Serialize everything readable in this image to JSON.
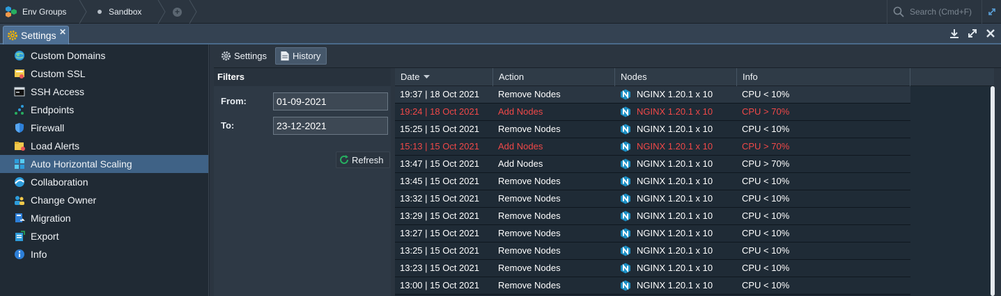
{
  "topbar": {
    "env_groups": "Env Groups",
    "sandbox": "Sandbox",
    "search_placeholder": "Search (Cmd+F)"
  },
  "tab": {
    "label": "Settings",
    "close": "✕"
  },
  "sidebar": {
    "items": [
      {
        "label": "Custom Domains",
        "icon": "globe-icon"
      },
      {
        "label": "Custom SSL",
        "icon": "certificate-icon"
      },
      {
        "label": "SSH Access",
        "icon": "terminal-icon"
      },
      {
        "label": "Endpoints",
        "icon": "endpoints-icon"
      },
      {
        "label": "Firewall",
        "icon": "shield-icon"
      },
      {
        "label": "Load Alerts",
        "icon": "alert-folder-icon"
      },
      {
        "label": "Auto Horizontal Scaling",
        "icon": "scaling-icon",
        "active": true
      },
      {
        "label": "Collaboration",
        "icon": "collaboration-icon"
      },
      {
        "label": "Change Owner",
        "icon": "change-owner-icon"
      },
      {
        "label": "Migration",
        "icon": "migration-icon"
      },
      {
        "label": "Export",
        "icon": "export-icon"
      },
      {
        "label": "Info",
        "icon": "info-icon"
      }
    ]
  },
  "subtabs": {
    "settings": "Settings",
    "history": "History"
  },
  "filters": {
    "title": "Filters",
    "from_label": "From:",
    "from_value": "01-09-2021",
    "to_label": "To:",
    "to_value": "23-12-2021",
    "refresh": "Refresh"
  },
  "grid": {
    "columns": [
      "Date",
      "Action",
      "Nodes",
      "Info"
    ],
    "rows": [
      {
        "date": "19:37 | 18 Oct 2021",
        "action": "Remove Nodes",
        "nodes": "NGINX 1.20.1 x 10",
        "info": "CPU < 10%",
        "alert": false
      },
      {
        "date": "19:24 | 18 Oct 2021",
        "action": "Add Nodes",
        "nodes": "NGINX 1.20.1 x 10",
        "info": "CPU > 70%",
        "alert": true
      },
      {
        "date": "15:25 | 15 Oct 2021",
        "action": "Remove Nodes",
        "nodes": "NGINX 1.20.1 x 10",
        "info": "CPU < 10%",
        "alert": false
      },
      {
        "date": "15:13 | 15 Oct 2021",
        "action": "Add Nodes",
        "nodes": "NGINX 1.20.1 x 10",
        "info": "CPU > 70%",
        "alert": true
      },
      {
        "date": "13:47 | 15 Oct 2021",
        "action": "Add Nodes",
        "nodes": "NGINX 1.20.1 x 10",
        "info": "CPU > 70%",
        "alert": false
      },
      {
        "date": "13:45 | 15 Oct 2021",
        "action": "Remove Nodes",
        "nodes": "NGINX 1.20.1 x 10",
        "info": "CPU < 10%",
        "alert": false
      },
      {
        "date": "13:32 | 15 Oct 2021",
        "action": "Remove Nodes",
        "nodes": "NGINX 1.20.1 x 10",
        "info": "CPU < 10%",
        "alert": false
      },
      {
        "date": "13:29 | 15 Oct 2021",
        "action": "Remove Nodes",
        "nodes": "NGINX 1.20.1 x 10",
        "info": "CPU < 10%",
        "alert": false
      },
      {
        "date": "13:27 | 15 Oct 2021",
        "action": "Remove Nodes",
        "nodes": "NGINX 1.20.1 x 10",
        "info": "CPU < 10%",
        "alert": false
      },
      {
        "date": "13:25 | 15 Oct 2021",
        "action": "Remove Nodes",
        "nodes": "NGINX 1.20.1 x 10",
        "info": "CPU < 10%",
        "alert": false
      },
      {
        "date": "13:23 | 15 Oct 2021",
        "action": "Remove Nodes",
        "nodes": "NGINX 1.20.1 x 10",
        "info": "CPU < 10%",
        "alert": false
      },
      {
        "date": "13:00 | 15 Oct 2021",
        "action": "Remove Nodes",
        "nodes": "NGINX 1.20.1 x 10",
        "info": "CPU < 10%",
        "alert": false
      }
    ]
  },
  "colors": {
    "accent": "#3f6286",
    "alert": "#f04848",
    "nginx": "#1b8fc4"
  }
}
